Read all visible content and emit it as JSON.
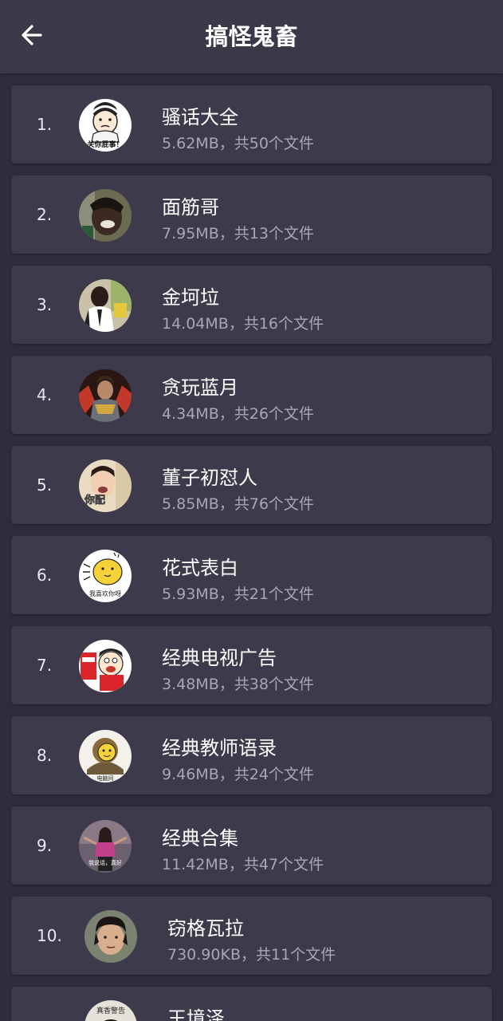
{
  "header": {
    "title": "搞怪鬼畜",
    "back_icon": "arrow-left-icon"
  },
  "colors": {
    "background": "#2f2d3d",
    "header": "#3b3948",
    "card": "#3d3b4b",
    "title_text": "#ffffff",
    "meta_text": "#a9a7b6"
  },
  "items": [
    {
      "index": "1.",
      "name": "骚话大全",
      "meta": "5.62MB，共50个文件",
      "avatar_caption": "关你屁事！"
    },
    {
      "index": "2.",
      "name": "面筋哥",
      "meta": "7.95MB，共13个文件",
      "avatar_caption": ""
    },
    {
      "index": "3.",
      "name": "金坷垃",
      "meta": "14.04MB，共16个文件",
      "avatar_caption": ""
    },
    {
      "index": "4.",
      "name": "贪玩蓝月",
      "meta": "4.34MB，共26个文件",
      "avatar_caption": ""
    },
    {
      "index": "5.",
      "name": "董子初怼人",
      "meta": "5.85MB，共76个文件",
      "avatar_caption": "你配"
    },
    {
      "index": "6.",
      "name": "花式表白",
      "meta": "5.93MB，共21个文件",
      "avatar_caption": "我喜欢你呀"
    },
    {
      "index": "7.",
      "name": "经典电视广告",
      "meta": "3.48MB，共38个文件",
      "avatar_caption": ""
    },
    {
      "index": "8.",
      "name": "经典教师语录",
      "meta": "9.46MB，共24个文件",
      "avatar_caption": "电脑间"
    },
    {
      "index": "9.",
      "name": "经典合集",
      "meta": "11.42MB，共47个文件",
      "avatar_caption": "我说话，真好"
    },
    {
      "index": "10.",
      "name": "窃格瓦拉",
      "meta": "730.90KB，共11个文件",
      "avatar_caption": ""
    },
    {
      "index": "",
      "name": "王境泽",
      "meta": "",
      "avatar_caption": "真香警告"
    }
  ]
}
